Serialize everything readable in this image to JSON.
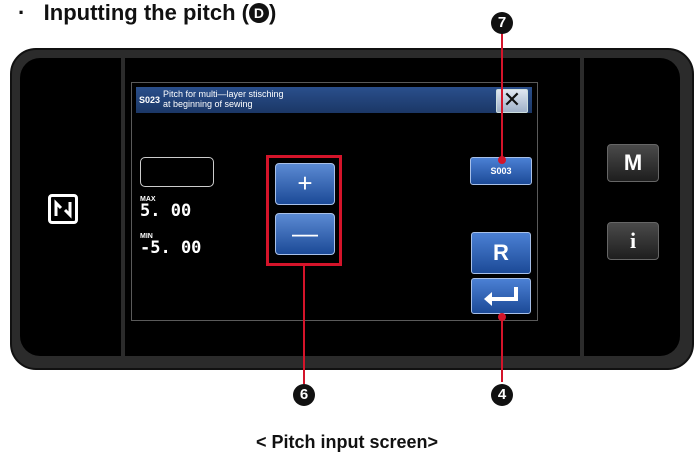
{
  "heading": {
    "bullet": "·",
    "text": "Inputting the pitch (",
    "circled_letter": "D",
    "close": ")"
  },
  "callouts": {
    "c7": "7",
    "c6": "6",
    "c4": "4"
  },
  "side_buttons": {
    "m_label": "M",
    "i_label": "i"
  },
  "dialog": {
    "code": "S023",
    "title_line1": "Pitch for multi—layer stisching",
    "title_line2": "at beginning of sewing",
    "close_label": "✕",
    "value": "",
    "max_label": "MAX",
    "max_value": "5. 00",
    "min_label": "MIN",
    "min_value": "-5. 00",
    "plus_label": "+",
    "minus_label": "—",
    "s003_label": "S003",
    "r_label": "R"
  },
  "caption": "< Pitch input screen>",
  "colors": {
    "accent": "#1c4a97",
    "callout_line": "#d4142a",
    "frame": "#2b2b2b"
  },
  "icons": [
    "nfc-icon",
    "close-icon",
    "enter-icon"
  ]
}
